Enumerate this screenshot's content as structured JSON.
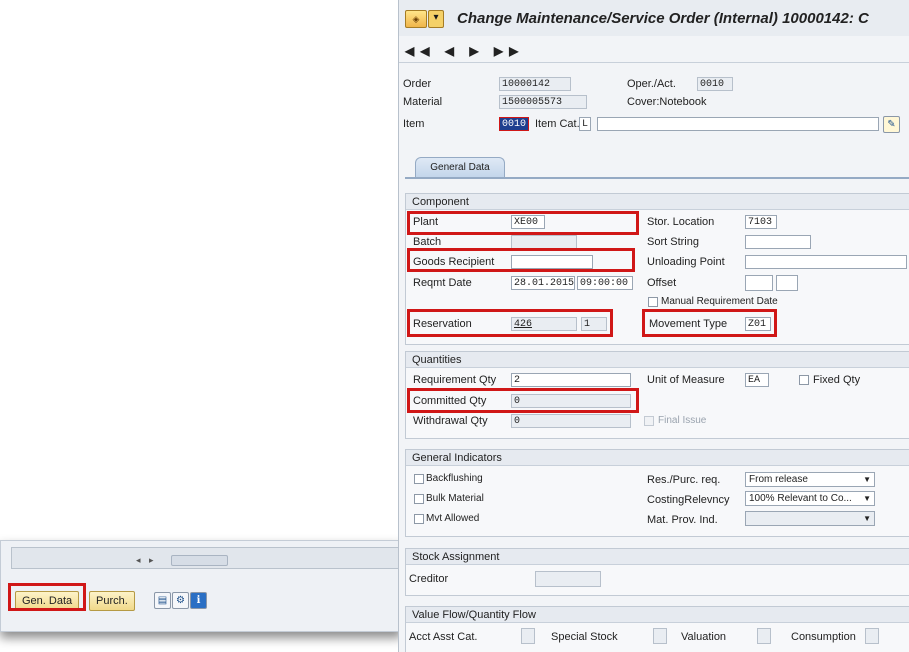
{
  "left_window": {
    "buttons": {
      "gen_data": "Gen. Data",
      "purch": "Purch."
    },
    "scroll_arrows": "◂ ▸",
    "icons": [
      "detail-icon",
      "structure-icon",
      "info-icon"
    ]
  },
  "window": {
    "title": "Change Maintenance/Service Order (Internal) 10000142: C",
    "nav": "◀◀ ◀ ▶ ▶▶"
  },
  "header": {
    "order_label": "Order",
    "order_value": "10000142",
    "operact_label": "Oper./Act.",
    "operact_value": "0010",
    "material_label": "Material",
    "material_value": "1500005573",
    "material_desc": "Cover:Notebook",
    "item_label": "Item",
    "item_value": "0010",
    "itemcat_label": "Item Cat.",
    "itemcat_value": "L",
    "item_text": ""
  },
  "tabs": [
    {
      "label": "General Data"
    }
  ],
  "component": {
    "title": "Component",
    "plant_label": "Plant",
    "plant_value": "XE00",
    "stor_label": "Stor. Location",
    "stor_value": "7103",
    "batch_label": "Batch",
    "batch_value": "",
    "sort_label": "Sort String",
    "sort_value": "",
    "recipient_label": "Goods Recipient",
    "recipient_value": "",
    "unloading_label": "Unloading Point",
    "unloading_value": "",
    "reqmt_label": "Reqmt Date",
    "reqmt_date": "28.01.2015",
    "reqmt_time": "09:00:00",
    "offset_label": "Offset",
    "manual_label": "Manual Requirement Date",
    "reservation_label": "Reservation",
    "reservation_value": "426",
    "reservation_item": "1",
    "movement_label": "Movement Type",
    "movement_value": "Z01"
  },
  "quantities": {
    "title": "Quantities",
    "req_label": "Requirement Qty",
    "req_value": "2",
    "uom_label": "Unit of Measure",
    "uom_value": "EA",
    "fixed_label": "Fixed Qty",
    "committed_label": "Committed Qty",
    "committed_value": "0",
    "withdrawal_label": "Withdrawal Qty",
    "withdrawal_value": "0",
    "final_label": "Final Issue"
  },
  "general_indicators": {
    "title": "General Indicators",
    "backflushing": "Backflushing",
    "bulk": "Bulk Material",
    "mvt": "Mvt Allowed",
    "respurc_label": "Res./Purc. req.",
    "respurc_value": "From release",
    "costing_label": "CostingRelevncy",
    "costing_value": "100% Relevant to Co...",
    "matprov_label": "Mat. Prov. Ind.",
    "matprov_value": ""
  },
  "stock_assignment": {
    "title": "Stock Assignment",
    "creditor_label": "Creditor",
    "creditor_value": ""
  },
  "value_flow": {
    "title": "Value Flow/Quantity Flow",
    "acct_label": "Acct Asst Cat.",
    "special_label": "Special Stock",
    "valuation_label": "Valuation",
    "consumption_label": "Consumption"
  },
  "colors": {
    "highlight": "#d01717",
    "button": "#f1d98a",
    "tab": "#c2d5ea"
  }
}
